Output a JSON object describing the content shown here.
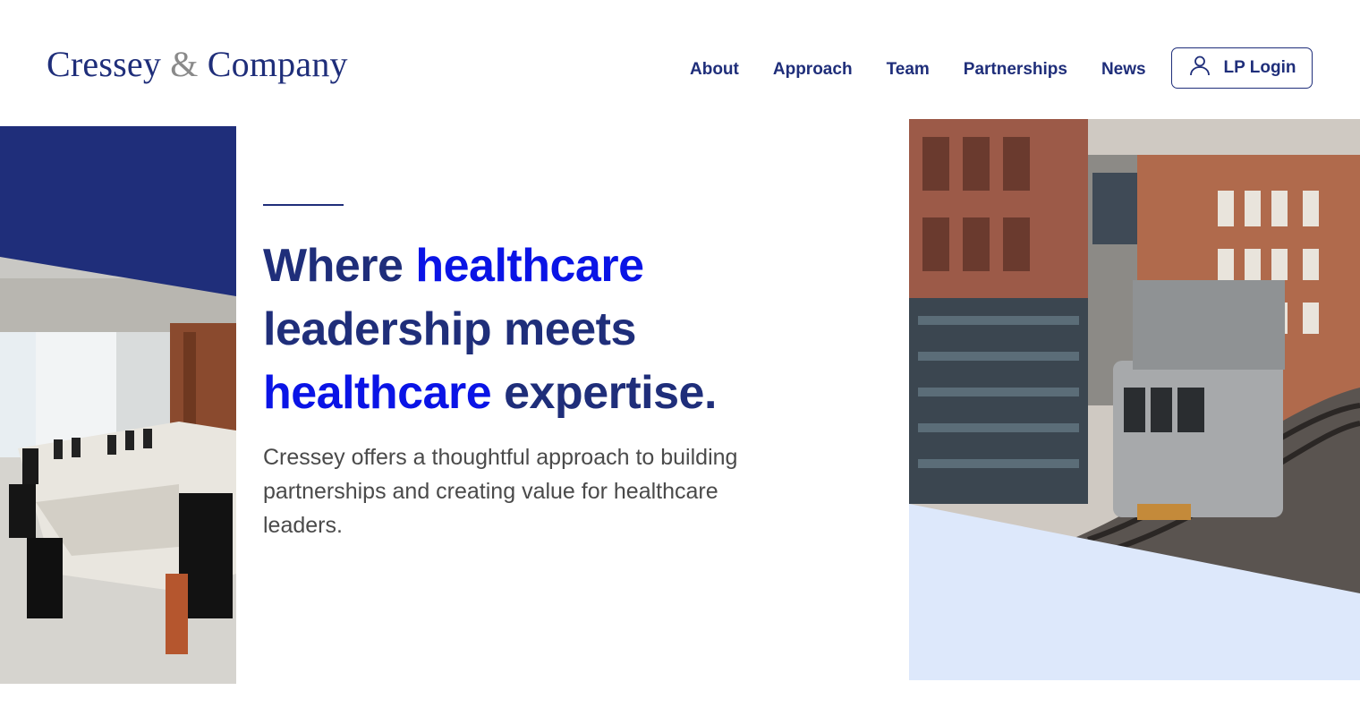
{
  "brand": {
    "name_part1": "Cressey",
    "ampersand": "&",
    "name_part2": "Company"
  },
  "nav": {
    "items": [
      "About",
      "Approach",
      "Team",
      "Partnerships",
      "News"
    ],
    "login_label": "LP Login",
    "login_icon": "user-icon"
  },
  "hero": {
    "headline": {
      "w1": "Where",
      "w2": "healthcare",
      "w3": "leadership meets",
      "w4": "healthcare",
      "w5": "expertise."
    },
    "subtext": "Cressey offers a thoughtful approach to building partnerships and creating value for healthcare leaders."
  },
  "colors": {
    "brand_navy": "#1f2e7a",
    "highlight_blue": "#0a14e6",
    "accent_light_blue": "#dde8fb",
    "body_gray": "#4a4a4a"
  },
  "images": {
    "left": "conference-room-photo",
    "right": "elevated-train-photo"
  }
}
